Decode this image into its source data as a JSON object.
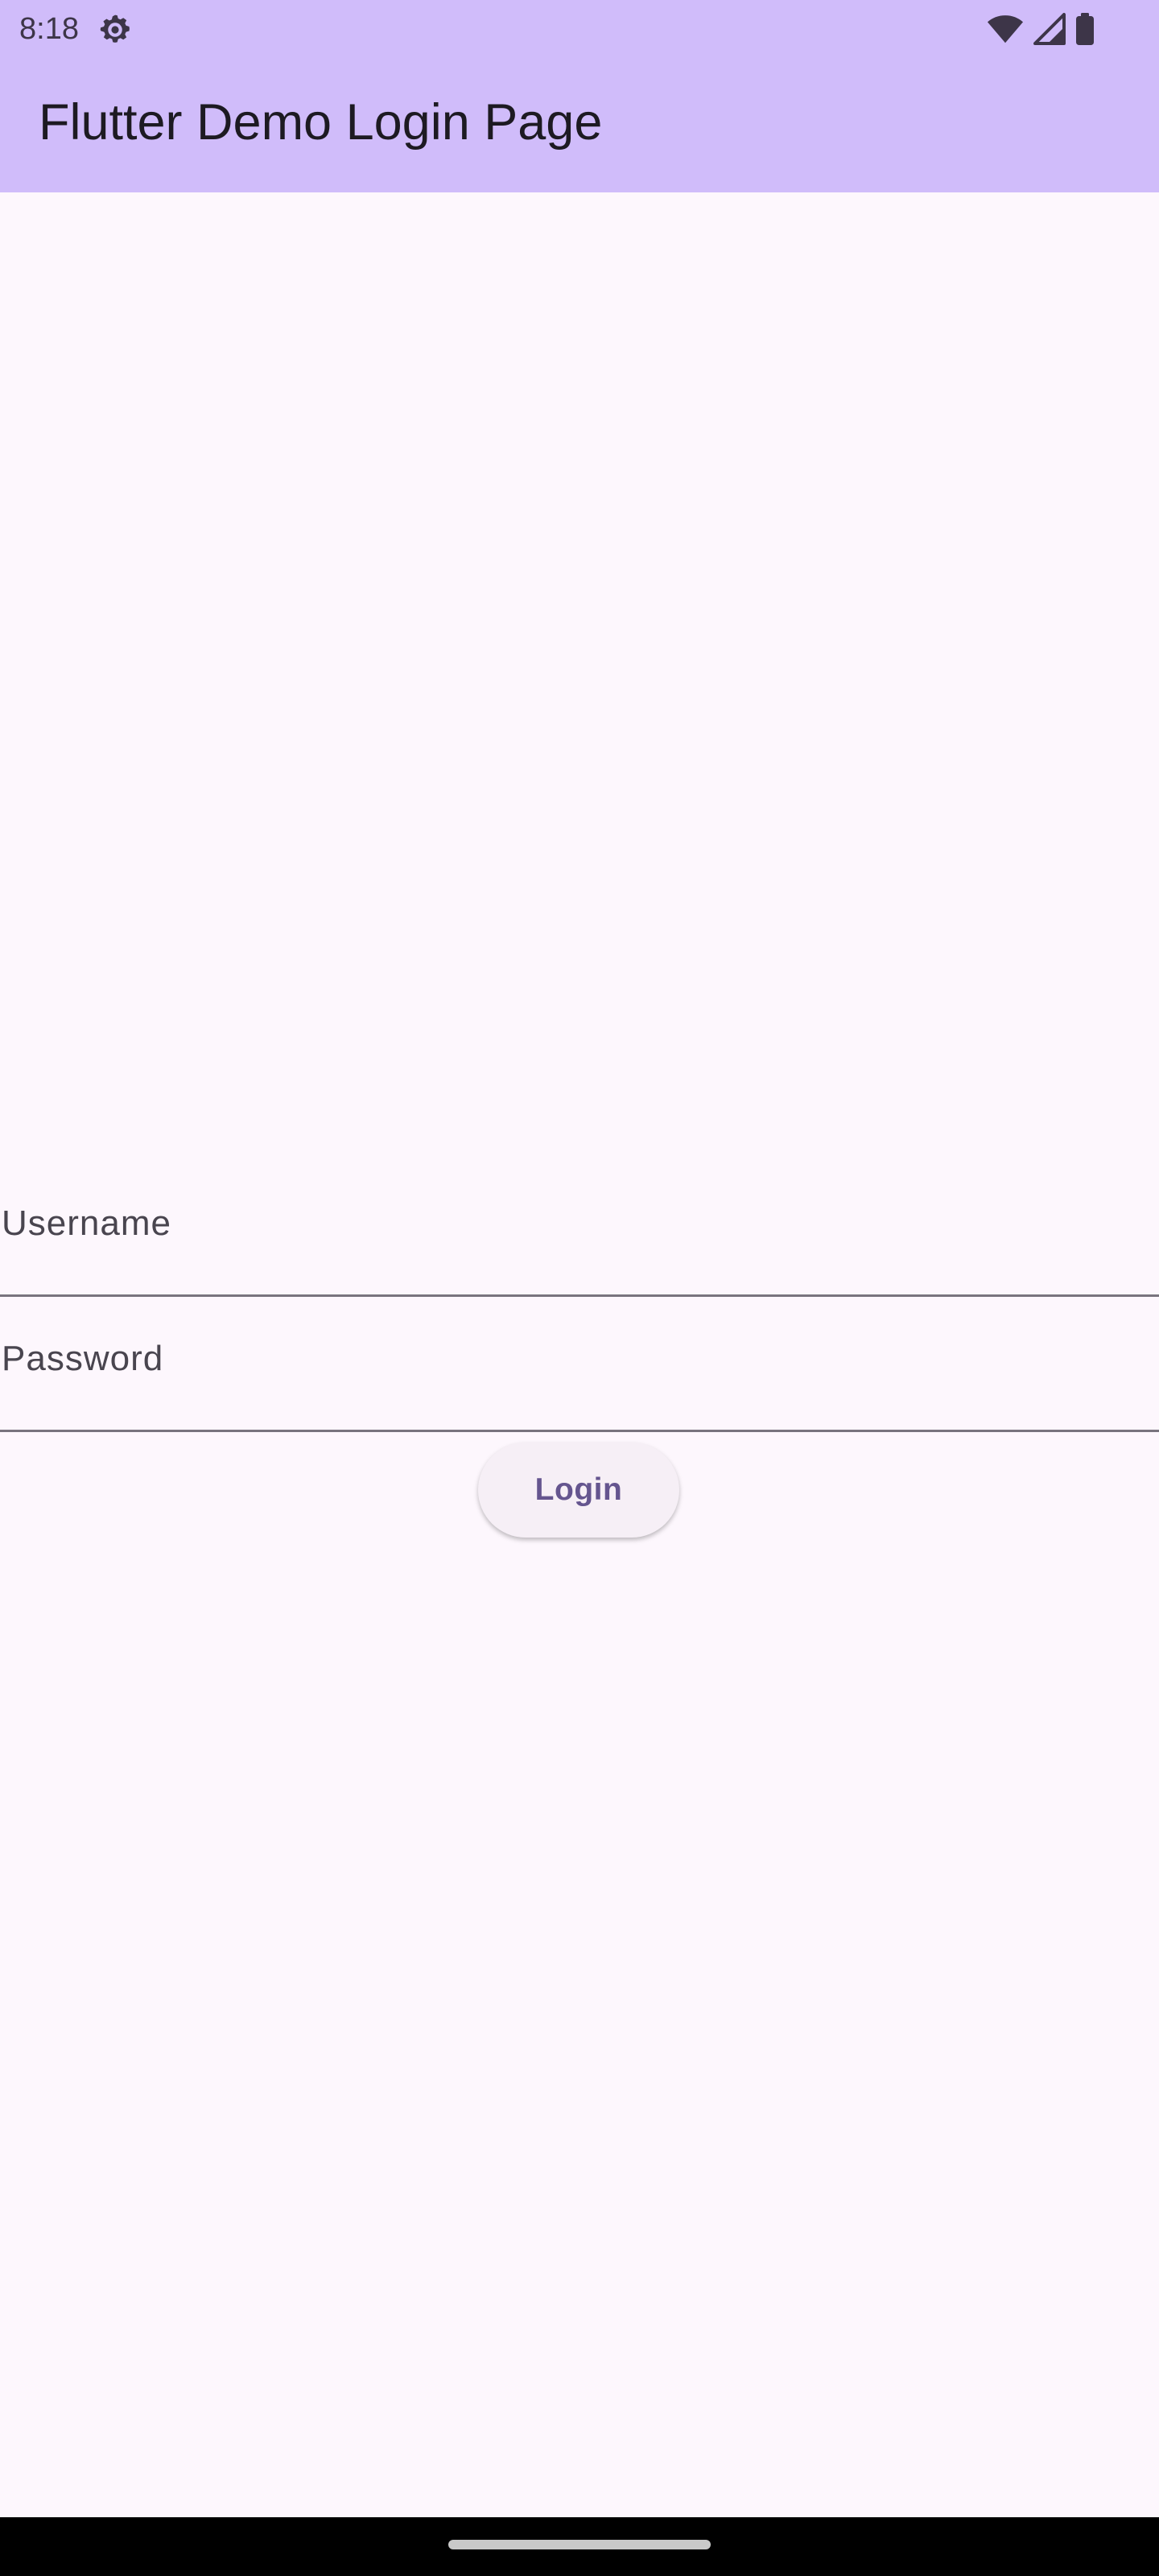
{
  "status_bar": {
    "time": "8:18",
    "icons": [
      "settings-gear-icon",
      "wifi-icon",
      "cell-signal-icon",
      "battery-icon"
    ]
  },
  "app_bar": {
    "title": "Flutter Demo Login Page"
  },
  "form": {
    "username": {
      "label": "Username",
      "value": ""
    },
    "password": {
      "label": "Password",
      "value": ""
    },
    "login_label": "Login"
  },
  "colors": {
    "app_bar_bg": "#d0bcfa",
    "page_bg": "#fdf7fd",
    "button_text": "#65558f",
    "button_bg": "#f6eff6"
  }
}
